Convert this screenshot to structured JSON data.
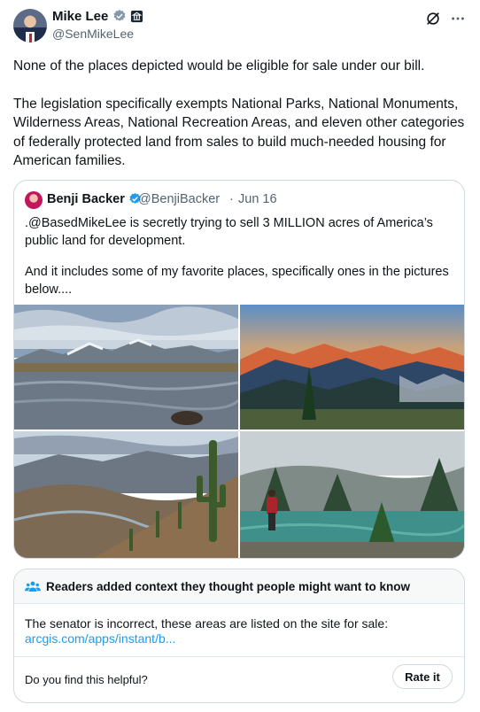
{
  "author": {
    "name": "Mike Lee",
    "handle": "@SenMikeLee"
  },
  "post": {
    "paragraph_1": "None of the places depicted would be eligible for sale under our bill.",
    "paragraph_2": "The legislation specifically exempts National Parks, National Monuments, Wilderness Areas, National Recreation Areas, and eleven other categories of federally protected land from sales to build much-needed housing for American families."
  },
  "quoted_post": {
    "name": "Benji Backer",
    "handle": "@BenjiBacker",
    "separator": "·",
    "date": "Jun 16",
    "paragraph_1": ".@BasedMikeLee is secretly trying to sell 3 MILLION acres of America’s public land for development.",
    "paragraph_2": "And it includes some of my favorite places, specifically ones in the pictures below....",
    "photos": [
      "lake-mountains-photo",
      "sunset-peaks-photo",
      "desert-cactus-photo",
      "forest-hiker-photo"
    ]
  },
  "community_note": {
    "title": "Readers added context they thought people might want to know",
    "text": "The senator is incorrect, these areas are listed on the site for sale:",
    "link": "arcgis.com/apps/instant/b...",
    "question": "Do you find this helpful?",
    "rate_label": "Rate it"
  },
  "colors": {
    "text": "#0f1419",
    "secondary": "#536471",
    "accent": "#1d9bf0",
    "border": "#cfd9de"
  },
  "icons": [
    "verified-badge-icon",
    "government-badge-icon",
    "grok-icon",
    "more-icon",
    "people-icon"
  ]
}
